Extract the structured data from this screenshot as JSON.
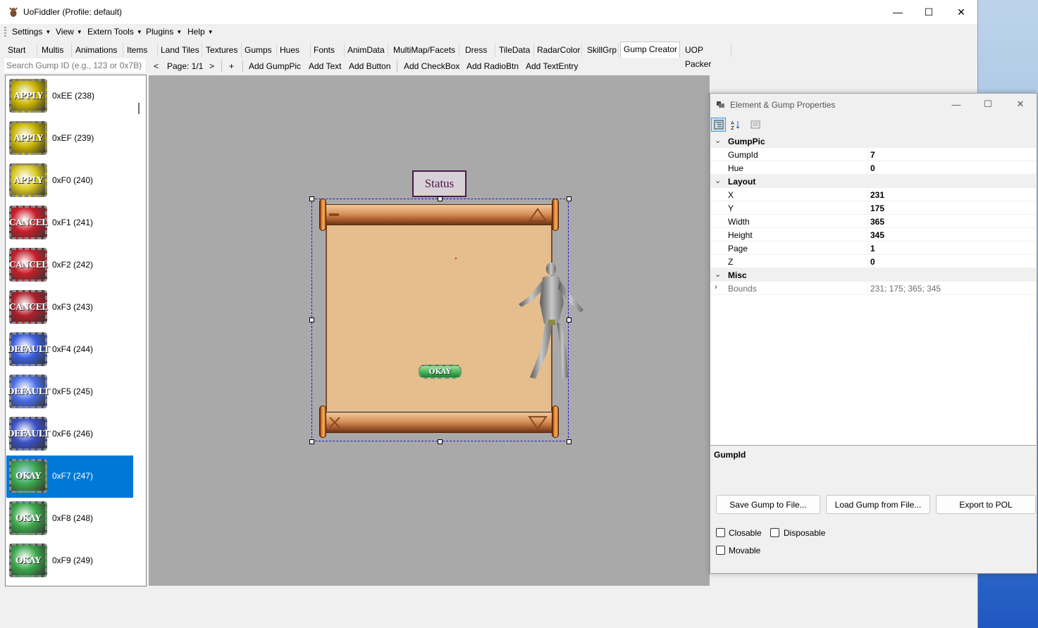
{
  "window": {
    "title": "UoFiddler (Profile: default)",
    "minimize": "—",
    "maximize": "☐",
    "close": "✕"
  },
  "menu": [
    {
      "label": "Settings"
    },
    {
      "label": "View"
    },
    {
      "label": "Extern Tools"
    },
    {
      "label": "Plugins"
    },
    {
      "label": "Help"
    }
  ],
  "tabs": [
    "Start",
    "Multis",
    "Animations",
    "Items",
    "Land Tiles",
    "Textures",
    "Gumps",
    "Hues",
    "Fonts",
    "AnimData",
    "MultiMap/Facets",
    "Dress",
    "TileData",
    "RadarColor",
    "SkillGrp",
    "Gump Creator",
    "UOP Packer"
  ],
  "active_tab": "Gump Creator",
  "toolbar": {
    "search_placeholder": "Search Gump ID (e.g., 123 or 0x7B)",
    "prev": "<",
    "page": "Page: 1/1",
    "next": ">",
    "add": "+",
    "add_gumppic": "Add GumpPic",
    "add_text": "Add Text",
    "add_button": "Add Button",
    "add_checkbox": "Add CheckBox",
    "add_radiobtn": "Add RadioBtn",
    "add_textentry": "Add TextEntry"
  },
  "gump_list": [
    {
      "label": "0xEE (238)",
      "art": "APPLY",
      "color": "#c9b400"
    },
    {
      "label": "0xEF (239)",
      "art": "APPLY",
      "color": "#c9b400"
    },
    {
      "label": "0xF0 (240)",
      "art": "APPLY",
      "color": "#d8c820"
    },
    {
      "label": "0xF1 (241)",
      "art": "CANCEL",
      "color": "#c81e2a"
    },
    {
      "label": "0xF2 (242)",
      "art": "CANCEL",
      "color": "#c81e2a"
    },
    {
      "label": "0xF3 (243)",
      "art": "CANCEL",
      "color": "#b01e2a"
    },
    {
      "label": "0xF4 (244)",
      "art": "DEFAULT",
      "color": "#3a5ee0"
    },
    {
      "label": "0xF5 (245)",
      "art": "DEFAULT",
      "color": "#4a6ee8"
    },
    {
      "label": "0xF6 (246)",
      "art": "DEFAULT",
      "color": "#3a50c8"
    },
    {
      "label": "0xF7 (247)",
      "art": "OKAY",
      "color": "#3aa84a"
    },
    {
      "label": "0xF8 (248)",
      "art": "OKAY",
      "color": "#3aa84a"
    },
    {
      "label": "0xF9 (249)",
      "art": "OKAY",
      "color": "#3aa84a"
    }
  ],
  "selected_gump": "0xF7 (247)",
  "canvas": {
    "status_label": "Status",
    "okay_label": "OKAY"
  },
  "props": {
    "title": "Element & Gump Properties",
    "sections": [
      {
        "category": "GumpPic"
      },
      {
        "name": "GumpId",
        "value": "7"
      },
      {
        "name": "Hue",
        "value": "0"
      },
      {
        "category": "Layout"
      },
      {
        "name": "X",
        "value": "231"
      },
      {
        "name": "Y",
        "value": "175"
      },
      {
        "name": "Width",
        "value": "365"
      },
      {
        "name": "Height",
        "value": "345"
      },
      {
        "name": "Page",
        "value": "1"
      },
      {
        "name": "Z",
        "value": "0"
      },
      {
        "category": "Misc"
      },
      {
        "name": "Bounds",
        "value": "231; 175; 365; 345",
        "collapsed": true
      }
    ],
    "description_title": "GumpId",
    "save_button": "Save Gump to File...",
    "load_button": "Load Gump from File...",
    "export_button": "Export to POL",
    "closable_label": "Closable",
    "disposable_label": "Disposable",
    "movable_label": "Movable"
  }
}
